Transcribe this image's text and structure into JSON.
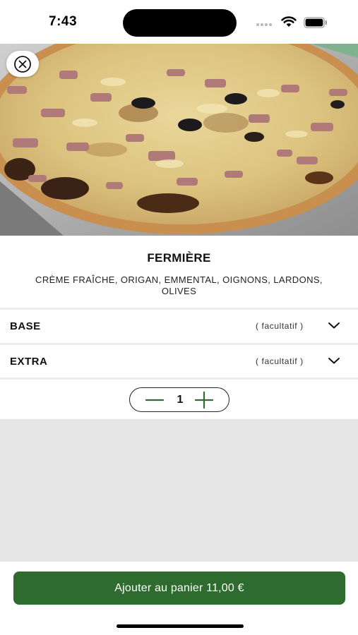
{
  "status_bar": {
    "time": "7:43"
  },
  "product": {
    "title": "FERMIÈRE",
    "description": "CRÈME FRAÎCHE, ORIGAN, EMMENTAL, OIGNONS, LARDONS, OLIVES"
  },
  "options": [
    {
      "label": "BASE",
      "note": "( facultatif )"
    },
    {
      "label": "EXTRA",
      "note": "( facultatif )"
    }
  ],
  "quantity": {
    "value": "1"
  },
  "cart_button": {
    "label": "Ajouter au panier 11,00 €"
  },
  "icons": {
    "close": "close-circle-icon",
    "chevron": "chevron-down-icon",
    "minus": "minus-icon",
    "plus": "plus-icon"
  },
  "colors": {
    "accent": "#2e6b2e",
    "grey_area": "#e6e6e6"
  }
}
